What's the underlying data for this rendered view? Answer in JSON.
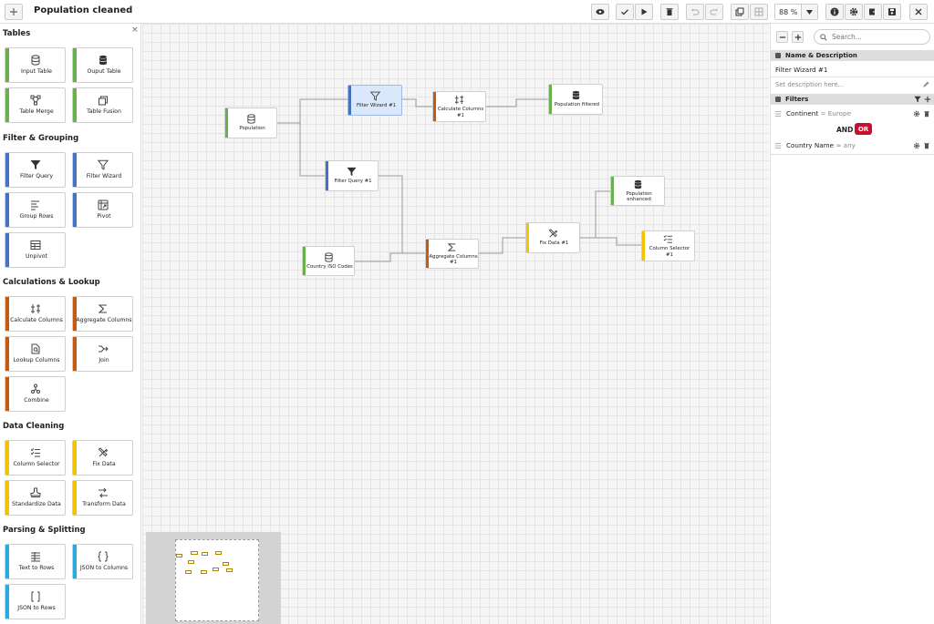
{
  "app": {
    "title": "Population cleaned",
    "zoom": "88 %"
  },
  "toolbar": {
    "add": "add-icon",
    "preview": "eye-icon",
    "validate": "check-icon",
    "run": "play-icon",
    "delete": "trash-icon",
    "undo": "undo-icon",
    "redo": "redo-icon",
    "group": "copy-icon",
    "grid": "grid-icon",
    "info": "info-icon",
    "settings": "gear-icon",
    "export": "export-icon",
    "save": "save-icon",
    "close": "close-icon"
  },
  "left_panel": {
    "close": "×",
    "sections": [
      {
        "title": "Tables",
        "items": [
          {
            "label": "Input Table",
            "icon": "database-outline-icon",
            "color": "#6ab04c"
          },
          {
            "label": "Ouput Table",
            "icon": "database-icon",
            "color": "#6ab04c"
          },
          {
            "label": "Table Merge",
            "icon": "merge-icon",
            "color": "#6ab04c"
          },
          {
            "label": "Table Fusion",
            "icon": "layers-icon",
            "color": "#6ab04c"
          }
        ]
      },
      {
        "title": "Filter & Grouping",
        "items": [
          {
            "label": "Filter Query",
            "icon": "filter-solid-icon",
            "color": "#4472c4"
          },
          {
            "label": "Filter Wizard",
            "icon": "filter-outline-icon",
            "color": "#4472c4"
          },
          {
            "label": "Group Rows",
            "icon": "list-icon",
            "color": "#4472c4"
          },
          {
            "label": "Pivot",
            "icon": "pivot-icon",
            "color": "#4472c4"
          },
          {
            "label": "Unpivot",
            "icon": "table-icon",
            "color": "#4472c4"
          }
        ]
      },
      {
        "title": "Calculations & Lookup",
        "items": [
          {
            "label": "Calculate Columns",
            "icon": "calc-icon",
            "color": "#c55a11"
          },
          {
            "label": "Aggregate Columns",
            "icon": "sigma-icon",
            "color": "#c55a11"
          },
          {
            "label": "Lookup Columns",
            "icon": "lookup-icon",
            "color": "#c55a11"
          },
          {
            "label": "Join",
            "icon": "join-icon",
            "color": "#c55a11"
          },
          {
            "label": "Combine",
            "icon": "combine-icon",
            "color": "#c55a11"
          }
        ]
      },
      {
        "title": "Data Cleaning",
        "items": [
          {
            "label": "Column Selector",
            "icon": "checklist-icon",
            "color": "#f2c300"
          },
          {
            "label": "Fix Data",
            "icon": "tools-icon",
            "color": "#f2c300"
          },
          {
            "label": "Standardize Data",
            "icon": "stamp-icon",
            "color": "#f2c300"
          },
          {
            "label": "Transform Data",
            "icon": "transform-icon",
            "color": "#f2c300"
          }
        ]
      },
      {
        "title": "Parsing & Splitting",
        "items": [
          {
            "label": "Text to Rows",
            "icon": "rows-icon",
            "color": "#29abe2"
          },
          {
            "label": "JSON to Columns",
            "icon": "braces-icon",
            "color": "#29abe2"
          },
          {
            "label": "JSON to Rows",
            "icon": "brackets-icon",
            "color": "#29abe2"
          }
        ]
      }
    ]
  },
  "flow": {
    "nodes": [
      {
        "id": "population",
        "label": "Population",
        "icon": "database-outline-icon",
        "color": "#6ab04c"
      },
      {
        "id": "filter_wizard",
        "label": "Filter Wizard #1",
        "icon": "filter-outline-icon",
        "color": "#4472c4",
        "selected": true
      },
      {
        "id": "calc_columns",
        "label": "Calculate Columns #1",
        "icon": "calc-icon",
        "color": "#c55a11"
      },
      {
        "id": "pop_filtered",
        "label": "Population filtered",
        "icon": "database-icon",
        "color": "#6ab04c"
      },
      {
        "id": "filter_query",
        "label": "Filter Query #1",
        "icon": "filter-solid-icon",
        "color": "#4472c4"
      },
      {
        "id": "country_iso",
        "label": "Country ISO Codes",
        "icon": "database-outline-icon",
        "color": "#6ab04c"
      },
      {
        "id": "aggregate",
        "label": "Aggregate Columns #1",
        "icon": "sigma-icon",
        "color": "#c55a11"
      },
      {
        "id": "fix_data",
        "label": "Fix Data #1",
        "icon": "tools-icon",
        "color": "#f2c300"
      },
      {
        "id": "pop_enhanced",
        "label": "Population enhanced",
        "icon": "database-icon",
        "color": "#6ab04c"
      },
      {
        "id": "col_selector",
        "label": "Column Selector #1",
        "icon": "checklist-icon",
        "color": "#f2c300"
      }
    ]
  },
  "right_panel": {
    "search_placeholder": "Search...",
    "name_section": "Name & Description",
    "name_value": "Filter Wizard #1",
    "description_placeholder": "Set description here...",
    "filters_section": "Filters",
    "filters": [
      {
        "field": "Continent",
        "op": "=",
        "value": "Europe"
      },
      {
        "field": "Country Name",
        "op": "≈",
        "value": "any"
      }
    ],
    "logic": {
      "and": "AND",
      "or": "OR"
    },
    "colors": {
      "or_active": "#c8102e"
    }
  }
}
